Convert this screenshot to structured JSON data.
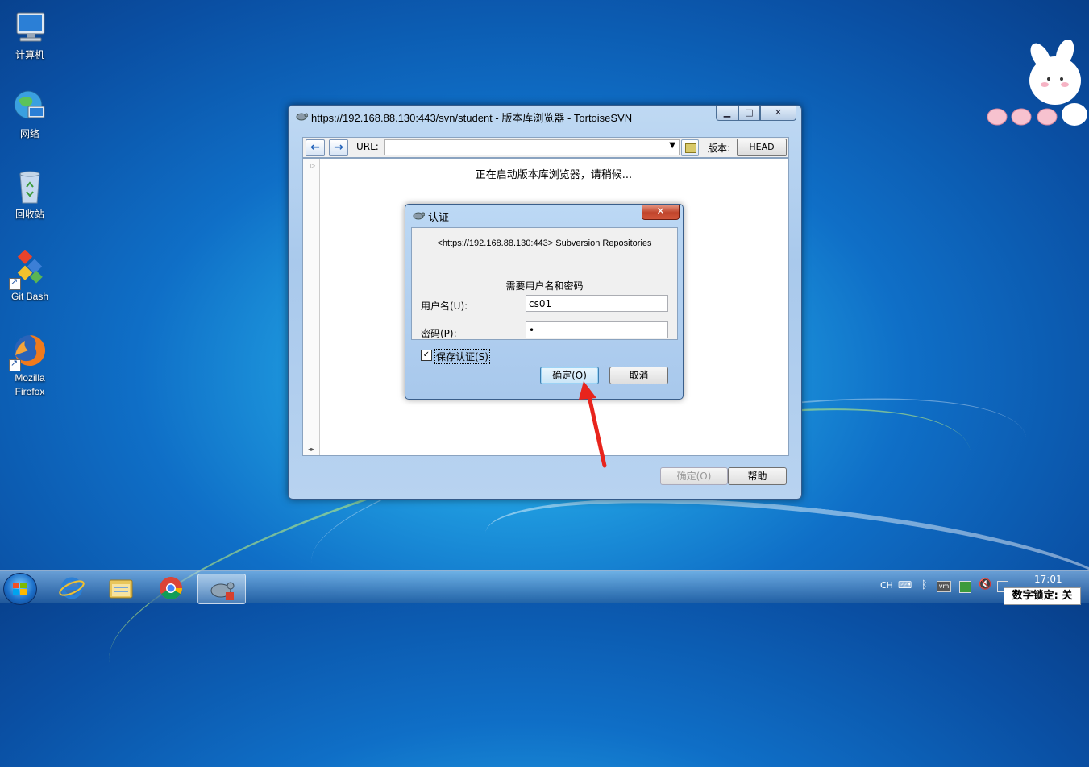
{
  "desktop": {
    "icons": [
      {
        "label": "计算机",
        "icon": "computer-icon"
      },
      {
        "label": "网络",
        "icon": "network-icon"
      },
      {
        "label": "回收站",
        "icon": "recycle-bin-icon"
      },
      {
        "label": "Git Bash",
        "icon": "git-bash-icon"
      },
      {
        "label": "Mozilla",
        "label2": "Firefox",
        "icon": "firefox-icon"
      }
    ]
  },
  "browser_window": {
    "title": "https://192.168.88.130:443/svn/student - 版本库浏览器 - TortoiseSVN",
    "min_glyph": "▁",
    "max_glyph": "□",
    "close_glyph": "✕",
    "back_glyph": "←",
    "forward_glyph": "→",
    "url_label": "URL:",
    "url_value": "",
    "dropdown_glyph": "▼",
    "revision_label": "版本:",
    "revision_button": "HEAD",
    "loading_text": "正在启动版本库浏览器，请稍候...",
    "ok_button": "确定(O)",
    "help_button": "帮助"
  },
  "auth_dialog": {
    "title": "认证",
    "close_glyph": "✕",
    "realm": "<https://192.168.88.130:443> Subversion Repositories",
    "prompt": "需要用户名和密码",
    "username_label": "用户名(U):",
    "username_value": "cs01",
    "password_label": "密码(P):",
    "password_value": "•",
    "save_auth_label": "保存认证(S)",
    "save_auth_checked": true,
    "check_glyph": "✓",
    "ok_button": "确定(O)",
    "cancel_button": "取消"
  },
  "taskbar": {
    "apps": [
      "internet-explorer-icon",
      "file-explorer-icon",
      "chrome-icon",
      "tortoisesvn-icon"
    ],
    "tray": {
      "language": "CH",
      "time": "17:01",
      "numlock_text": "数字锁定: 关"
    }
  },
  "colors": {
    "annotation_arrow": "#e8241c"
  }
}
